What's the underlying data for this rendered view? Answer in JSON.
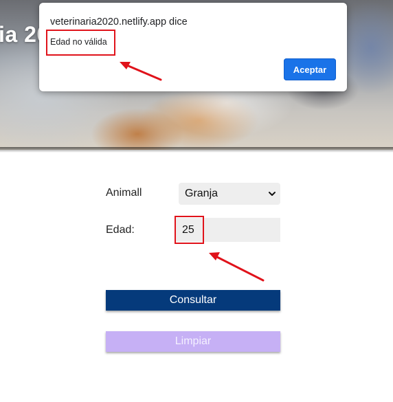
{
  "banner": {
    "title": "ia 20"
  },
  "dialog": {
    "origin": "veterinaria2020.netlify.app dice",
    "message": "Edad no válida",
    "ok_label": "Aceptar"
  },
  "form": {
    "animal_label": "Animall",
    "animal_selected": "Granja",
    "edad_label": "Edad:",
    "edad_value": "25",
    "consultar_label": "Consultar",
    "limpiar_label": "Limpiar"
  },
  "colors": {
    "dialog_button": "#1a73e8",
    "consultar": "#053a7b",
    "limpiar": "#c6b0f5",
    "annotation": "#e0121a"
  },
  "icons": {
    "select_caret": "chevron-down-icon"
  }
}
